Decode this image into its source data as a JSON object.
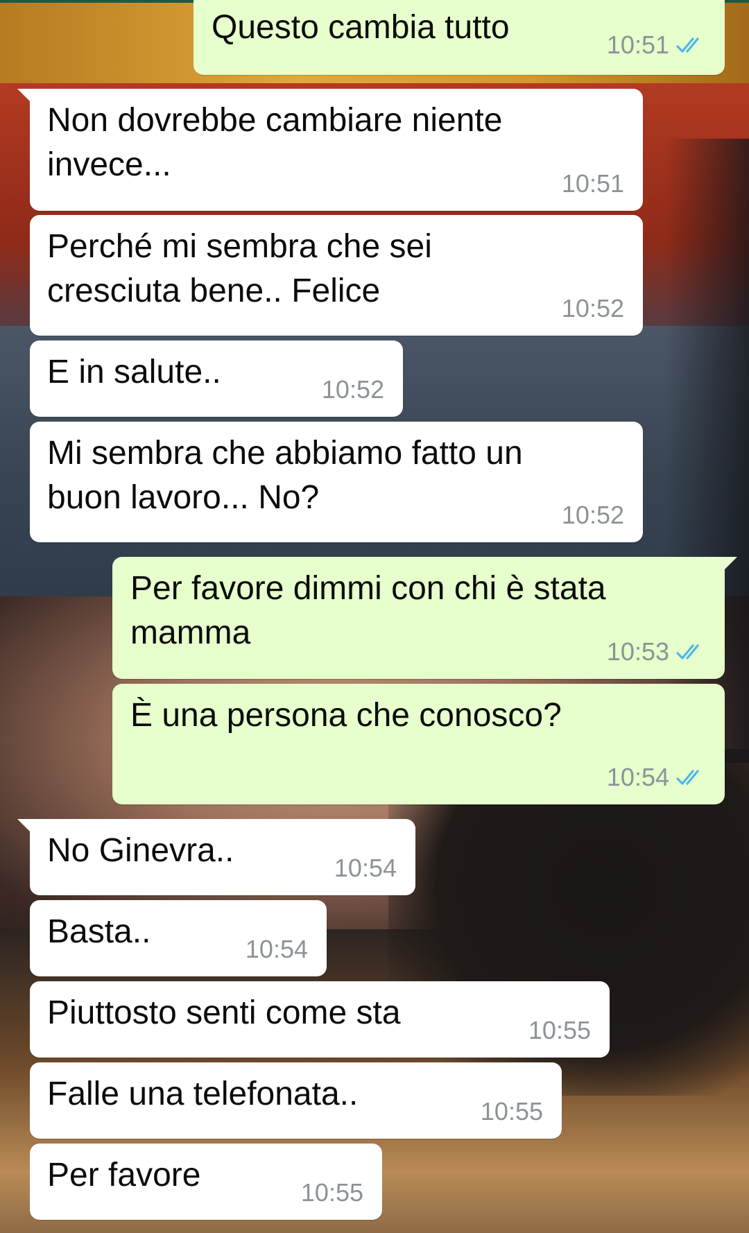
{
  "messages": [
    {
      "text": "Questo cambia tutto",
      "time": "10:51",
      "direction": "out",
      "status": "read"
    },
    {
      "text": "Non dovrebbe cambiare niente\ninvece...",
      "time": "10:51",
      "direction": "in"
    },
    {
      "text": "Perché mi sembra che sei\ncresciuta bene.. Felice",
      "time": "10:52",
      "direction": "in"
    },
    {
      "text": "E in salute..",
      "time": "10:52",
      "direction": "in"
    },
    {
      "text": "Mi sembra che abbiamo fatto un\nbuon lavoro... No?",
      "time": "10:52",
      "direction": "in"
    },
    {
      "text": "Per favore dimmi con chi è stata\nmamma",
      "time": "10:53",
      "direction": "out",
      "status": "read"
    },
    {
      "text": "È una persona che conosco?",
      "time": "10:54",
      "direction": "out",
      "status": "read"
    },
    {
      "text": "No Ginevra..",
      "time": "10:54",
      "direction": "in"
    },
    {
      "text": "Basta..",
      "time": "10:54",
      "direction": "in"
    },
    {
      "text": "Piuttosto senti come sta",
      "time": "10:55",
      "direction": "in"
    },
    {
      "text": "Falle una telefonata..",
      "time": "10:55",
      "direction": "in"
    },
    {
      "text": "Per favore",
      "time": "10:55",
      "direction": "in"
    }
  ],
  "colors": {
    "incoming_bubble": "#ffffff",
    "outgoing_bubble": "#e6ffcc",
    "timestamp": "#8c9396",
    "read_ticks": "#4fb6ec"
  },
  "icons": {
    "read_status": "double-check-icon"
  }
}
